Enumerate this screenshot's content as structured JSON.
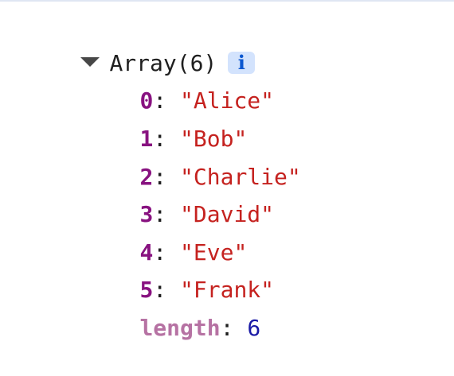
{
  "console": {
    "array_label": "Array(6)",
    "info_badge": "i",
    "items": [
      {
        "index": "0",
        "value": "\"Alice\""
      },
      {
        "index": "1",
        "value": "\"Bob\""
      },
      {
        "index": "2",
        "value": "\"Charlie\""
      },
      {
        "index": "3",
        "value": "\"David\""
      },
      {
        "index": "4",
        "value": "\"Eve\""
      },
      {
        "index": "5",
        "value": "\"Frank\""
      }
    ],
    "length_key": "length",
    "length_value": "6",
    "colon": ": "
  },
  "colors": {
    "key": "#881280",
    "string": "#c5221f",
    "length_key": "#b672a3",
    "number": "#1a1aa6",
    "badge_bg": "#d3e3fd",
    "badge_text": "#0b57d0"
  }
}
